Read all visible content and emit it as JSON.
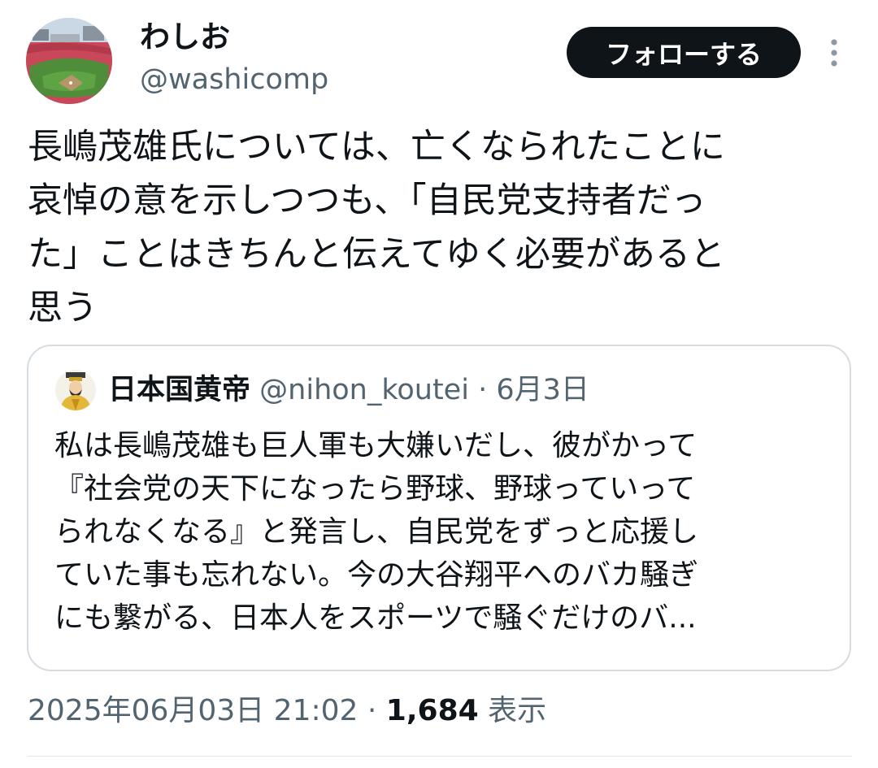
{
  "author": {
    "display_name": "わしお",
    "handle": "@washicomp"
  },
  "actions": {
    "follow_label": "フォローする"
  },
  "tweet": {
    "lines": [
      "長嶋茂雄氏については、亡くなられたことに",
      "哀悼の意を示しつつも、「自民党支持者だっ",
      "た」ことはきちんと伝えてゆく必要があると",
      "思う"
    ]
  },
  "quote": {
    "display_name": "日本国黄帝",
    "handle": "@nihon_koutei",
    "separator": "·",
    "date": "6月3日",
    "lines": [
      "私は長嶋茂雄も巨人軍も大嫌いだし、彼がかって",
      "『社会党の天下になったら野球、野球っていって",
      "られなくなる』と発言し、自民党をずっと応援し",
      "ていた事も忘れない。今の大谷翔平へのバカ騒ぎ",
      "にも繋がる、日本人をスポーツで騒ぐだけのバ..."
    ]
  },
  "meta": {
    "timestamp": "2025年06月03日 21:02",
    "separator": "·",
    "views_count": "1,684",
    "views_label": "表示"
  },
  "icons": {
    "avatar": "stadium-avatar-icon",
    "quote_avatar": "emperor-avatar-icon",
    "more": "more-vertical-icon"
  },
  "colors": {
    "primary_text": "#0f1419",
    "secondary_text": "#536471",
    "follow_button_bg": "#0f1419",
    "border": "#d6dde2"
  }
}
